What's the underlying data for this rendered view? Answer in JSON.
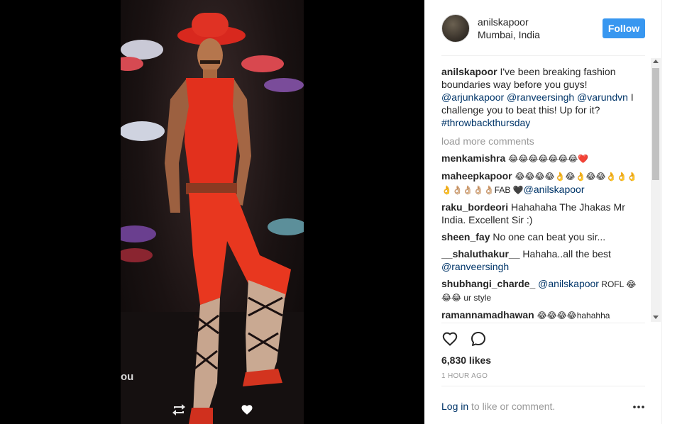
{
  "post": {
    "username": "anilskapoor",
    "location": "Mumbai, India",
    "follow_label": "Follow",
    "video_overlay_text": "ou"
  },
  "caption": {
    "author": "anilskapoor",
    "text_1": " I've been breaking fashion boundaries way before you guys! ",
    "mention_1": "@arjunkapoor",
    "mention_2": "@ranveersingh",
    "mention_3": "@varundvn",
    "text_2": " I challenge you to beat this! Up for it? ",
    "hashtag": "#throwbackthursday"
  },
  "load_more": "load more comments",
  "comments": [
    {
      "author": "menkamishra",
      "text": "😂😂😂😂😂😂😂❤️"
    },
    {
      "author": "maheepkapoor",
      "text": "😂😂😂😂👌😂👌😂😂👌👌👌👌👌🏼👌🏼👌🏼👌🏼FAB 🖤",
      "mention": "@anilskapoor",
      "after": ""
    },
    {
      "author": "raku_bordeori",
      "text": "Hahahaha The Jhakas Mr India. Excellent Sir :)"
    },
    {
      "author": "sheen_fay",
      "text": "No one can beat you sir..."
    },
    {
      "author": "__shaluthakur__",
      "text": "Hahaha..all the best ",
      "mention": "@ranveersingh",
      "after": ""
    },
    {
      "author": "shubhangi_charde_",
      "text": "",
      "mention": "@anilskapoor",
      "after": " ROFL 😂😂😂 ur style"
    },
    {
      "author": "ramannamadhawan",
      "text": "😂😂😂😂hahahha"
    }
  ],
  "likes": "6,830 likes",
  "time": "1 HOUR AGO",
  "login": {
    "link": "Log in",
    "rest": " to like or comment."
  },
  "colors": {
    "accent": "#3897f0",
    "link": "#003569",
    "muted": "#999999"
  },
  "icons": {
    "like": "heart-outline-icon",
    "comment": "speech-bubble-icon",
    "more": "ellipsis-icon",
    "repost": "repost-icon",
    "small_heart": "heart-filled-icon"
  }
}
